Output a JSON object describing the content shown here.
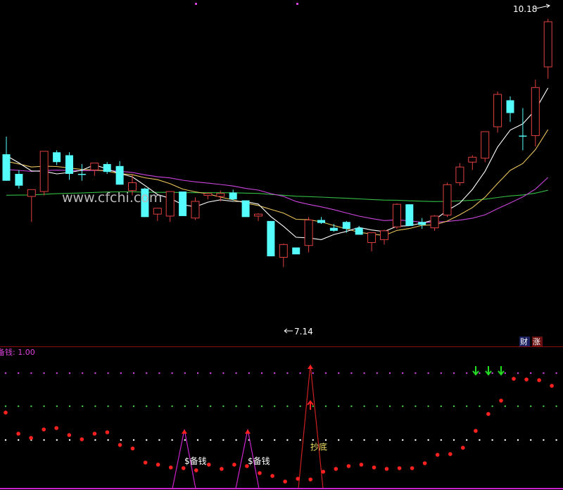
{
  "watermark": "www.cfchi.com",
  "colors": {
    "background": "#000000",
    "up": "#e04040",
    "down": "#54fcfc",
    "ma5": "#ffffff",
    "ma10": "#e8c25a",
    "ma20": "#cc44dd",
    "ma60": "#33bb44",
    "divider": "#8a1010",
    "sub_dot": "#ff2020"
  },
  "main": {
    "high_label": "10.18",
    "low_label": "7.14"
  },
  "sub": {
    "indicator_label": "备钱: 1.00",
    "badge_cai": "财",
    "badge_zhang": "涨",
    "signal_buy": "$备钱",
    "signal_buy2": "$备钱",
    "signal_bottom": "抄底"
  },
  "chart_data": [
    {
      "type": "candlestick",
      "price_range": [
        7.0,
        10.3
      ],
      "high": 10.18,
      "low": 7.14,
      "candles": [
        {
          "o": 8.8,
          "h": 8.98,
          "l": 8.53,
          "c": 8.53,
          "dir": "down"
        },
        {
          "o": 8.6,
          "h": 8.64,
          "l": 8.45,
          "c": 8.48,
          "dir": "down"
        },
        {
          "o": 8.37,
          "h": 8.44,
          "l": 8.11,
          "c": 8.44,
          "dir": "up"
        },
        {
          "o": 8.42,
          "h": 8.83,
          "l": 8.38,
          "c": 8.83,
          "dir": "up"
        },
        {
          "o": 8.82,
          "h": 8.84,
          "l": 8.69,
          "c": 8.72,
          "dir": "down"
        },
        {
          "o": 8.79,
          "h": 8.82,
          "l": 8.54,
          "c": 8.6,
          "dir": "down"
        },
        {
          "o": 8.6,
          "h": 8.7,
          "l": 8.53,
          "c": 8.6,
          "dir": "down"
        },
        {
          "o": 8.64,
          "h": 8.71,
          "l": 8.58,
          "c": 8.71,
          "dir": "up"
        },
        {
          "o": 8.7,
          "h": 8.72,
          "l": 8.6,
          "c": 8.62,
          "dir": "down"
        },
        {
          "o": 8.68,
          "h": 8.73,
          "l": 8.49,
          "c": 8.49,
          "dir": "down"
        },
        {
          "o": 8.51,
          "h": 8.59,
          "l": 8.38,
          "c": 8.43,
          "dir": "up"
        },
        {
          "o": 8.45,
          "h": 8.46,
          "l": 8.16,
          "c": 8.16,
          "dir": "down"
        },
        {
          "o": 8.19,
          "h": 8.25,
          "l": 8.12,
          "c": 8.25,
          "dir": "up"
        },
        {
          "o": 8.17,
          "h": 8.42,
          "l": 8.11,
          "c": 8.42,
          "dir": "up"
        },
        {
          "o": 8.42,
          "h": 8.42,
          "l": 8.17,
          "c": 8.17,
          "dir": "down"
        },
        {
          "o": 8.15,
          "h": 8.36,
          "l": 8.13,
          "c": 8.32,
          "dir": "up"
        },
        {
          "o": 8.38,
          "h": 8.41,
          "l": 8.34,
          "c": 8.4,
          "dir": "up"
        },
        {
          "o": 8.4,
          "h": 8.43,
          "l": 8.32,
          "c": 8.37,
          "dir": "up"
        },
        {
          "o": 8.41,
          "h": 8.44,
          "l": 8.33,
          "c": 8.34,
          "dir": "down"
        },
        {
          "o": 8.33,
          "h": 8.33,
          "l": 8.16,
          "c": 8.16,
          "dir": "down"
        },
        {
          "o": 8.17,
          "h": 8.2,
          "l": 8.12,
          "c": 8.19,
          "dir": "up"
        },
        {
          "o": 8.12,
          "h": 8.12,
          "l": 7.76,
          "c": 7.76,
          "dir": "down"
        },
        {
          "o": 7.75,
          "h": 7.89,
          "l": 7.65,
          "c": 7.88,
          "dir": "up"
        },
        {
          "o": 7.85,
          "h": 7.85,
          "l": 7.78,
          "c": 7.78,
          "dir": "down"
        },
        {
          "o": 7.87,
          "h": 8.16,
          "l": 7.8,
          "c": 8.13,
          "dir": "up"
        },
        {
          "o": 8.13,
          "h": 8.16,
          "l": 8.09,
          "c": 8.1,
          "dir": "down"
        },
        {
          "o": 8.05,
          "h": 8.09,
          "l": 8.01,
          "c": 8.02,
          "dir": "down"
        },
        {
          "o": 8.11,
          "h": 8.12,
          "l": 8.0,
          "c": 8.04,
          "dir": "down"
        },
        {
          "o": 8.05,
          "h": 8.07,
          "l": 7.98,
          "c": 7.98,
          "dir": "down"
        },
        {
          "o": 7.9,
          "h": 8.0,
          "l": 7.81,
          "c": 8.0,
          "dir": "up"
        },
        {
          "o": 7.93,
          "h": 8.03,
          "l": 7.88,
          "c": 8.02,
          "dir": "up"
        },
        {
          "o": 8.06,
          "h": 8.3,
          "l": 8.04,
          "c": 8.29,
          "dir": "up"
        },
        {
          "o": 8.29,
          "h": 8.29,
          "l": 8.07,
          "c": 8.07,
          "dir": "down"
        },
        {
          "o": 8.08,
          "h": 8.15,
          "l": 8.04,
          "c": 8.11,
          "dir": "down"
        },
        {
          "o": 8.05,
          "h": 8.18,
          "l": 8.02,
          "c": 8.17,
          "dir": "up"
        },
        {
          "o": 8.18,
          "h": 8.51,
          "l": 8.16,
          "c": 8.49,
          "dir": "up"
        },
        {
          "o": 8.51,
          "h": 8.71,
          "l": 8.48,
          "c": 8.67,
          "dir": "up"
        },
        {
          "o": 8.72,
          "h": 8.79,
          "l": 8.64,
          "c": 8.77,
          "dir": "up"
        },
        {
          "o": 8.76,
          "h": 9.03,
          "l": 8.72,
          "c": 9.03,
          "dir": "up"
        },
        {
          "o": 9.08,
          "h": 9.44,
          "l": 9.02,
          "c": 9.41,
          "dir": "up"
        },
        {
          "o": 9.22,
          "h": 9.39,
          "l": 9.13,
          "c": 9.35,
          "dir": "down"
        },
        {
          "o": 8.98,
          "h": 9.27,
          "l": 8.84,
          "c": 8.99,
          "dir": "down"
        },
        {
          "o": 8.99,
          "h": 9.56,
          "l": 8.88,
          "c": 9.48,
          "dir": "up"
        },
        {
          "o": 9.69,
          "h": 10.18,
          "l": 9.57,
          "c": 10.15,
          "dir": "up"
        }
      ],
      "ma_lines": [
        "MA5",
        "MA10",
        "MA20",
        "MA60"
      ]
    },
    {
      "type": "scatter",
      "title": "备钱",
      "current_value": 1.0,
      "reference_levels": [
        1,
        2,
        3
      ],
      "signals": [
        "$备钱",
        "$备钱",
        "抄底"
      ]
    }
  ]
}
